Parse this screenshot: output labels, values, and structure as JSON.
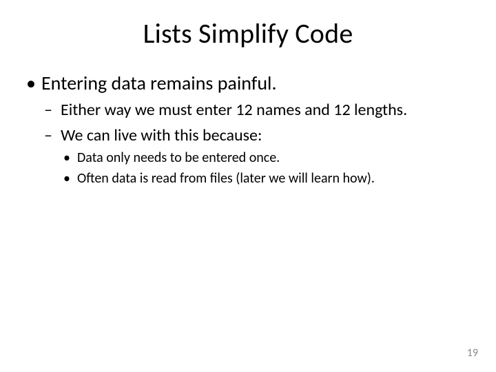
{
  "title": "Lists Simplify Code",
  "bullets": {
    "lvl1": [
      {
        "text": "Entering data remains painful.",
        "lvl2": [
          {
            "text": "Either way we must enter 12 names and 12 lengths."
          },
          {
            "text": "We can live with this because:",
            "lvl3": [
              {
                "text": "Data only needs to be entered once."
              },
              {
                "text": "Often data is read from files (later we will learn how)."
              }
            ]
          }
        ]
      }
    ]
  },
  "page_number": "19"
}
